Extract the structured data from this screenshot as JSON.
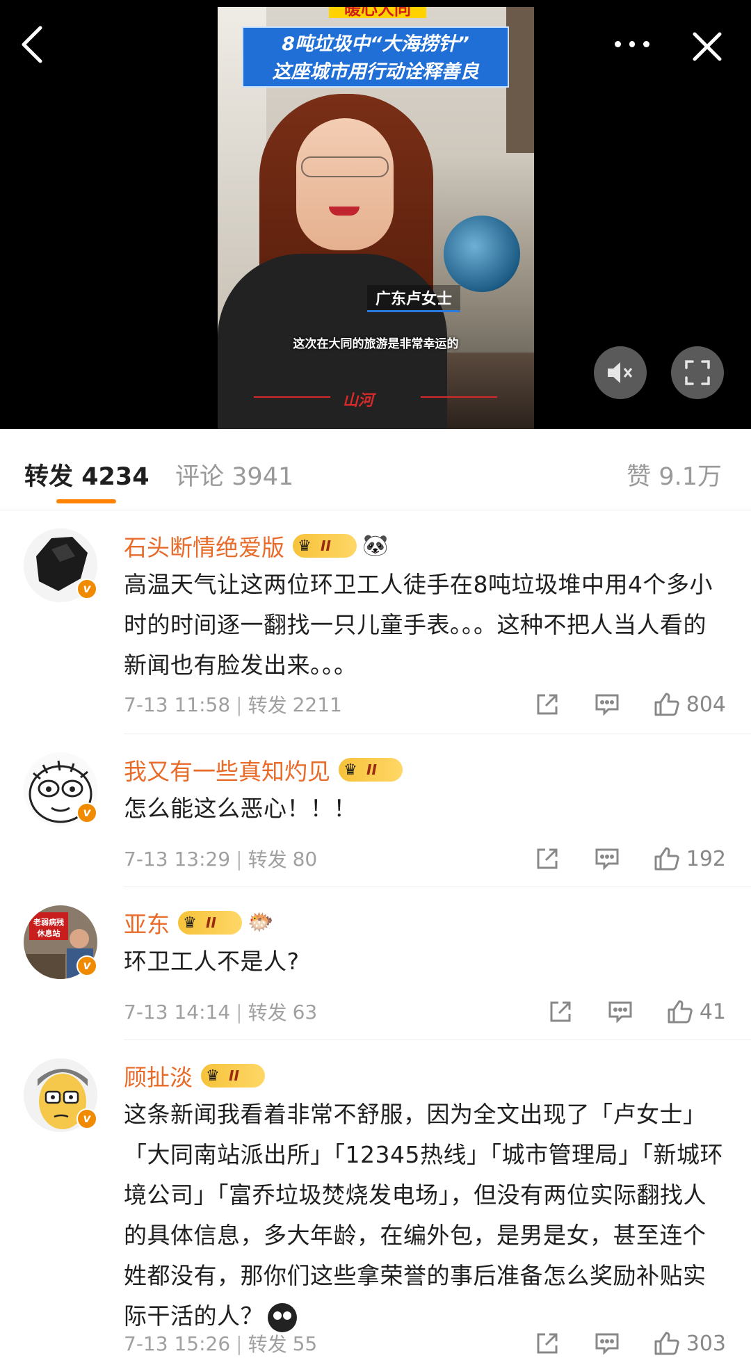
{
  "video": {
    "headline_top": "暖心大同",
    "headline_line1": "8吨垃圾中“大海捞针”",
    "headline_line2": "这座城市用行动诠释善良",
    "name_tag": "广东卢女士",
    "subtitle": "这次在大同的旅游是非常幸运的",
    "brand": "山河"
  },
  "tabs": {
    "repost_label": "转发",
    "repost_count": "4234",
    "comment_label": "评论",
    "comment_count": "3941",
    "like_label": "赞",
    "like_count": "9.1万"
  },
  "comments": [
    {
      "username": "石头断情绝爱版",
      "vip_level": "II",
      "emoji": "🐼",
      "text": "高温天气让这两位环卫工人徒手在8吨垃圾堆中用4个多小时的时间逐一翻找一只儿童手表。。。这种不把人当人看的新闻也有脸发出来。。。",
      "time": "7-13 11:58",
      "repost_label": "转发",
      "repost_count": "2211",
      "likes": "804"
    },
    {
      "username": "我又有一些真知灼见",
      "vip_level": "II",
      "emoji": "",
      "text": "怎么能这么恶心！！！",
      "time": "7-13 13:29",
      "repost_label": "转发",
      "repost_count": "80",
      "likes": "192"
    },
    {
      "username": "亚东",
      "vip_level": "II",
      "emoji": "🐡",
      "text": "环卫工人不是人?",
      "avatar_sign": "老弱病残休息站",
      "time": "7-13 14:14",
      "repost_label": "转发",
      "repost_count": "63",
      "likes": "41"
    },
    {
      "username": "顾扯淡",
      "vip_level": "II",
      "emoji": "",
      "text": "这条新闻我看着非常不舒服，因为全文出现了「卢女士」「大同南站派出所」「12345热线」「城市管理局」「新城环境公司」「富乔垃圾焚烧发电场」，但没有两位实际翻找人的具体信息，多大年龄，在编外包，是男是女，甚至连个姓都没有，那你们这些拿荣誉的事后准备怎么奖励补贴实际干活的人？",
      "time": "7-13 15:26",
      "repost_label": "转发",
      "repost_count": "55",
      "likes": "303"
    }
  ],
  "colors": {
    "username": "#e86b2a",
    "tab_indicator": "#ff8200",
    "vip_gold": "#f6c23a",
    "meta_gray": "#a0a0a0"
  }
}
